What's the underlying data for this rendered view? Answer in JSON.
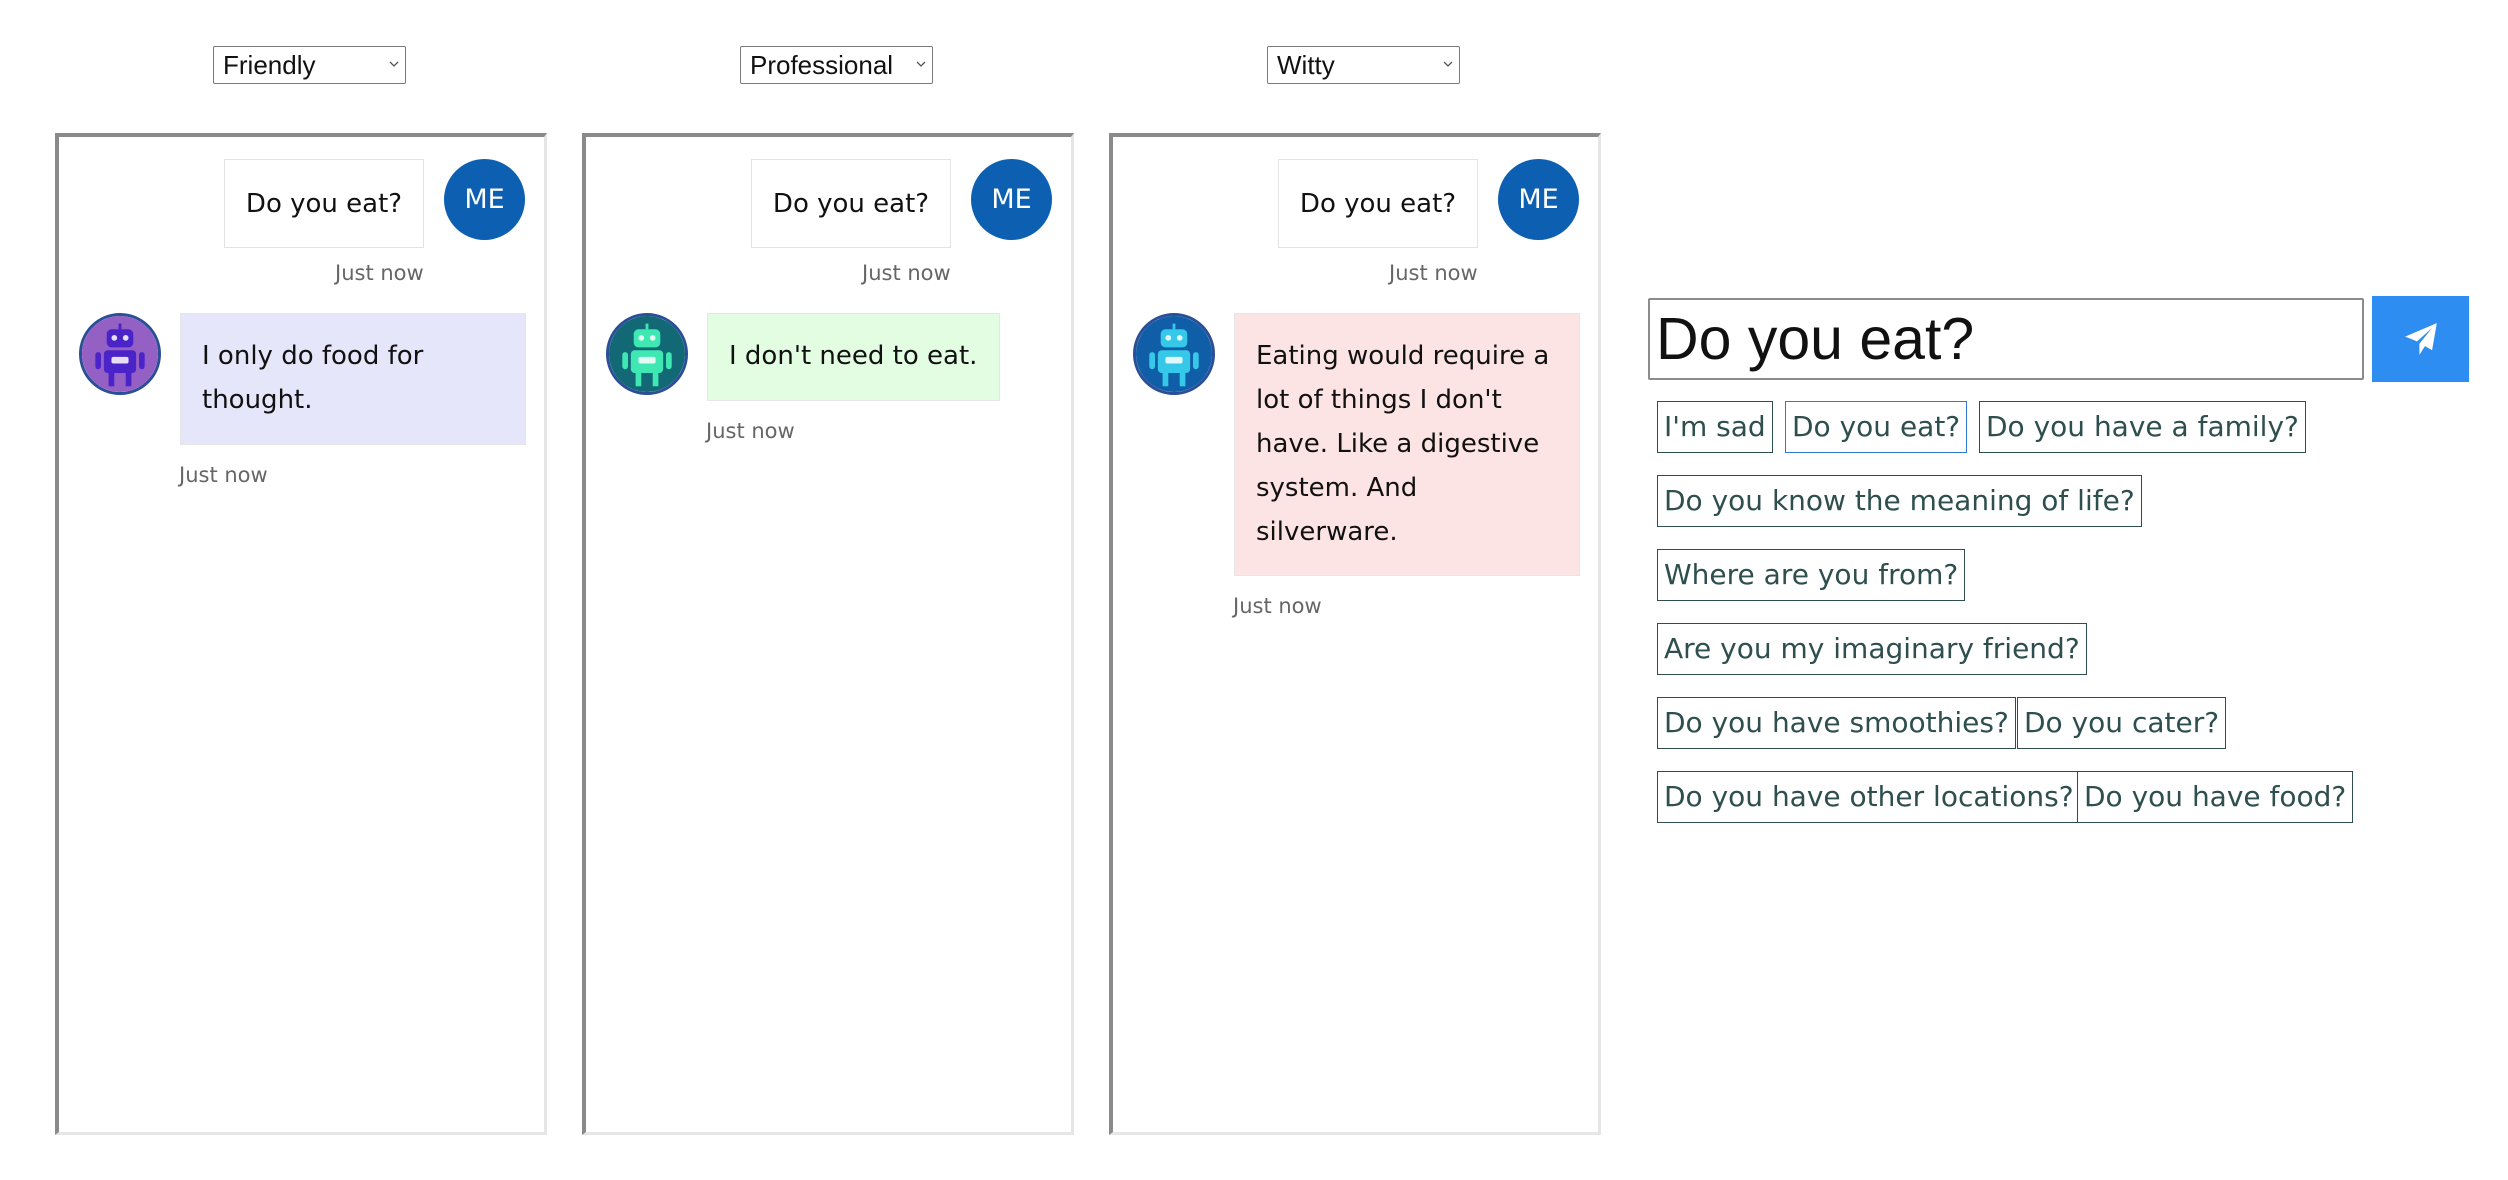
{
  "selectors": [
    {
      "value": "Friendly"
    },
    {
      "value": "Professional"
    },
    {
      "value": "Witty"
    }
  ],
  "panels": [
    {
      "user_message": "Do you eat?",
      "user_avatar": "ME",
      "user_time": "Just now",
      "bot_message": "I only do food for thought.",
      "bot_time": "Just now",
      "bot_bubble_color": "#e6e6fa",
      "bot_avatar_bg": "#9560c4",
      "bot_robot_color": "#4b24c9",
      "bot_avatar_icon": "robot-icon"
    },
    {
      "user_message": "Do you eat?",
      "user_avatar": "ME",
      "user_time": "Just now",
      "bot_message": "I don't need to eat.",
      "bot_time": "Just now",
      "bot_bubble_color": "#e3fde3",
      "bot_avatar_bg": "#136876",
      "bot_robot_color": "#3fe8b2",
      "bot_avatar_icon": "robot-icon"
    },
    {
      "user_message": "Do you eat?",
      "user_avatar": "ME",
      "user_time": "Just now",
      "bot_message": "Eating would require a lot of things I don't have. Like a digestive system. And silverware.",
      "bot_time": "Just now",
      "bot_bubble_color": "#fde4e4",
      "bot_avatar_bg": "#0f5ea7",
      "bot_robot_color": "#35c8e8",
      "bot_avatar_icon": "robot-icon"
    }
  ],
  "composer": {
    "value": "Do you eat?",
    "send_icon": "send-icon",
    "send_color": "#2e8df0"
  },
  "suggestions": [
    "I'm sad",
    "Do you eat?",
    "Do you have a family?",
    "Do you know the meaning of life?",
    "Where are you from?",
    "Are you my imaginary friend?",
    "Do you have smoothies?",
    "Do you cater?",
    "Do you have other locations?",
    "Do you have food?"
  ]
}
